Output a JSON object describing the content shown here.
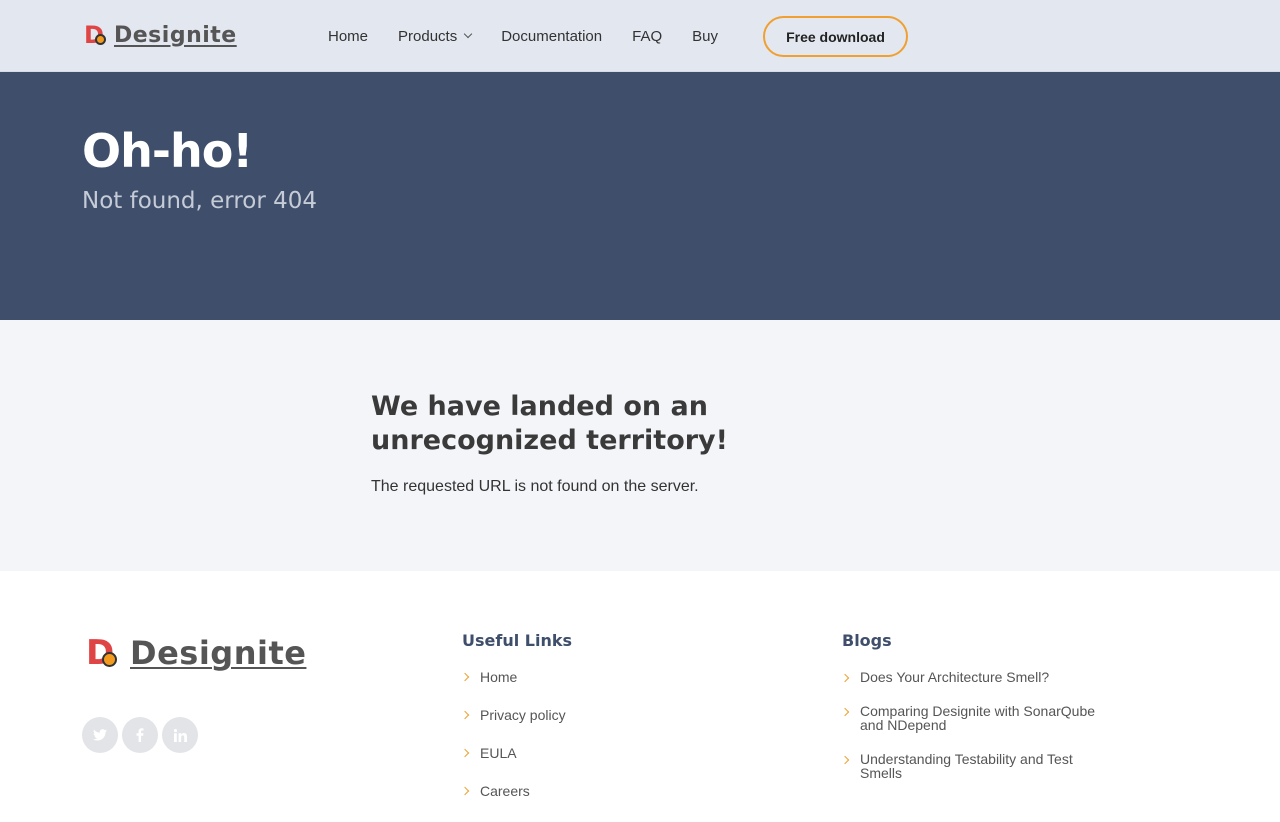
{
  "brand": {
    "name": "Designite"
  },
  "nav": {
    "items": [
      "Home",
      "Products",
      "Documentation",
      "FAQ",
      "Buy"
    ],
    "cta": "Free download"
  },
  "hero": {
    "title": "Oh-ho!",
    "subtitle": "Not found, error 404"
  },
  "message": {
    "heading": "We have landed on an unrecognized territory!",
    "text": "The requested URL is not found on the server."
  },
  "footer": {
    "socials": [
      "twitter-icon",
      "facebook-icon",
      "linkedin-icon"
    ],
    "useful_links": {
      "title": "Useful Links",
      "items": [
        "Home",
        "Privacy policy",
        "EULA",
        "Careers"
      ]
    },
    "blogs": {
      "title": "Blogs",
      "items": [
        "Does Your Architecture Smell?",
        "Comparing Designite with SonarQube and NDepend",
        "Understanding Testability and Test Smells"
      ]
    }
  },
  "colors": {
    "accent": "#f0a030",
    "hero_bg": "#3e4e6b",
    "header_bg": "#e3e7f0",
    "message_bg": "#f4f5f9"
  }
}
